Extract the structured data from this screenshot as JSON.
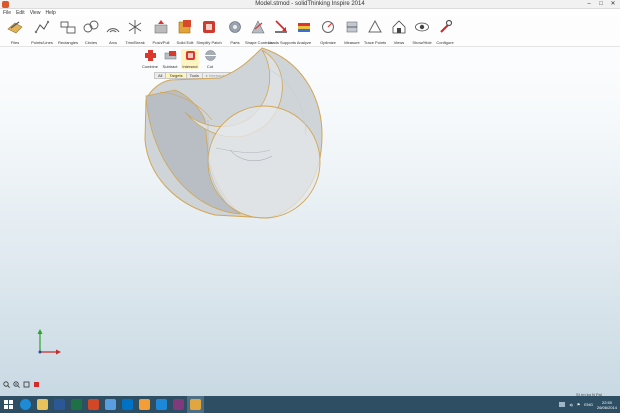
{
  "window": {
    "title": "Model.stmod - solidThinking Inspire 2014"
  },
  "menu": [
    "File",
    "Edit",
    "View",
    "Help"
  ],
  "ribbon": {
    "tools": [
      {
        "label": "Files",
        "icon": "files-icon"
      },
      {
        "label": "Points/Lines",
        "icon": "points-lines-icon"
      },
      {
        "label": "Rectangles",
        "icon": "rectangles-icon"
      },
      {
        "label": "Circles",
        "icon": "circles-icon"
      },
      {
        "label": "Arcs",
        "icon": "arcs-icon"
      },
      {
        "label": "Trim/Break",
        "icon": "trim-break-icon"
      },
      {
        "label": "Push/Pull",
        "icon": "push-pull-icon"
      },
      {
        "label": "Solid Edit",
        "icon": "solid-edit-icon"
      },
      {
        "label": "Simplify Patch",
        "icon": "simplify-patch-icon"
      },
      {
        "label": "Parts",
        "icon": "parts-icon"
      },
      {
        "label": "Shape Controls",
        "icon": "shape-controls-icon"
      },
      {
        "label": "Loads Supports",
        "icon": "loads-supports-icon"
      },
      {
        "label": "Analyze",
        "icon": "analyze-icon"
      },
      {
        "label": "Optimize",
        "icon": "optimize-icon"
      },
      {
        "label": "Measure",
        "icon": "measure-icon"
      },
      {
        "label": "Trace Points",
        "icon": "trace-points-icon"
      },
      {
        "label": "Views",
        "icon": "views-icon"
      },
      {
        "label": "Show/Hide",
        "icon": "show-hide-icon"
      },
      {
        "label": "Configure",
        "icon": "configure-icon"
      }
    ]
  },
  "boolean_tools": [
    {
      "label": "Combine",
      "icon": "combine-icon"
    },
    {
      "label": "Subtract",
      "icon": "subtract-icon"
    },
    {
      "label": "Intersect",
      "icon": "intersect-icon"
    },
    {
      "label": "Cut",
      "icon": "cut-icon"
    }
  ],
  "modebar": {
    "all": "All",
    "targets": "Targets",
    "tools": "Tools",
    "intersect": "Intersect"
  },
  "status": {
    "units": "SI (m kg N Pa)"
  },
  "taskbar": {
    "apps": [
      "start",
      "internet-explorer",
      "file-explorer",
      "word",
      "excel",
      "powerpoint",
      "onedrive",
      "outlook",
      "media-player",
      "lync",
      "onenote",
      "solidthinking"
    ],
    "lang": "ENG",
    "time": "22:50",
    "date": "26/06/2014"
  }
}
